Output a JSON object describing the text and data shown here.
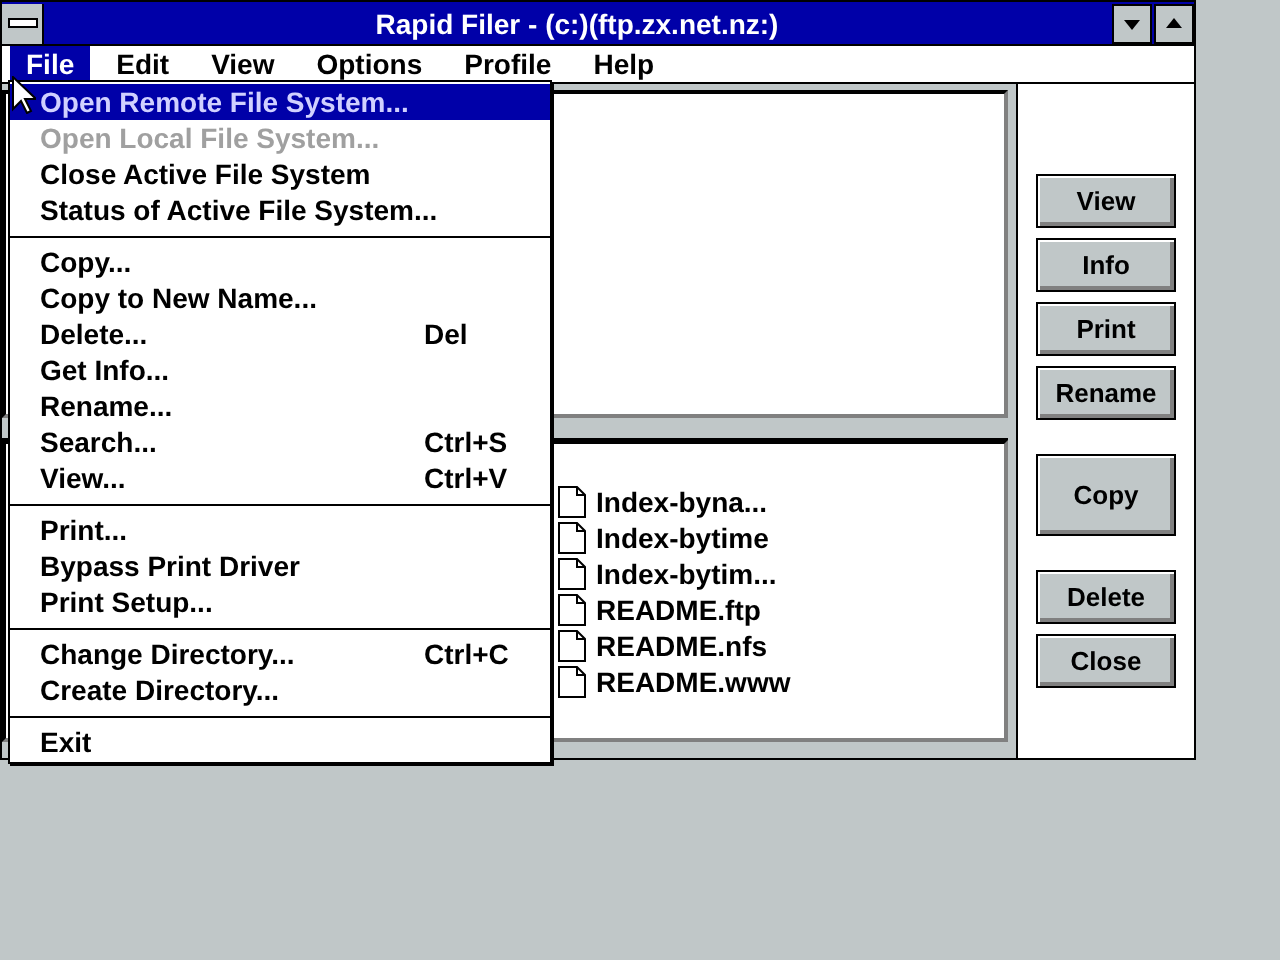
{
  "window": {
    "title": "Rapid Filer - (c:)(ftp.zx.net.nz:)"
  },
  "menu_bar": [
    {
      "label": "File",
      "selected": true
    },
    {
      "label": "Edit",
      "selected": false
    },
    {
      "label": "View",
      "selected": false
    },
    {
      "label": "Options",
      "selected": false
    },
    {
      "label": "Profile",
      "selected": false
    },
    {
      "label": "Help",
      "selected": false
    }
  ],
  "file_menu": [
    {
      "kind": "item",
      "label": "Open Remote File System...",
      "disabled": true,
      "selected": true
    },
    {
      "kind": "item",
      "label": "Open Local File System...",
      "disabled": true,
      "selected": false
    },
    {
      "kind": "item",
      "label": "Close Active File System",
      "disabled": false,
      "selected": false
    },
    {
      "kind": "item",
      "label": "Status of Active File System...",
      "disabled": false,
      "selected": false
    },
    {
      "kind": "separator"
    },
    {
      "kind": "item",
      "label": "Copy...",
      "disabled": false,
      "selected": false
    },
    {
      "kind": "item",
      "label": "Copy to New Name...",
      "disabled": false,
      "selected": false
    },
    {
      "kind": "item",
      "label": "Delete...",
      "shortcut": "Del",
      "disabled": false,
      "selected": false
    },
    {
      "kind": "item",
      "label": "Get Info...",
      "disabled": false,
      "selected": false
    },
    {
      "kind": "item",
      "label": "Rename...",
      "disabled": false,
      "selected": false
    },
    {
      "kind": "item",
      "label": "Search...",
      "shortcut": "Ctrl+S",
      "disabled": false,
      "selected": false
    },
    {
      "kind": "item",
      "label": "View...",
      "shortcut": "Ctrl+V",
      "disabled": false,
      "selected": false
    },
    {
      "kind": "separator"
    },
    {
      "kind": "item",
      "label": "Print...",
      "disabled": false,
      "selected": false
    },
    {
      "kind": "item",
      "label": "Bypass Print Driver",
      "disabled": false,
      "selected": false
    },
    {
      "kind": "item",
      "label": "Print Setup...",
      "disabled": false,
      "selected": false
    },
    {
      "kind": "separator"
    },
    {
      "kind": "item",
      "label": "Change Directory...",
      "shortcut": "Ctrl+C",
      "disabled": false,
      "selected": false
    },
    {
      "kind": "item",
      "label": "Create Directory...",
      "disabled": false,
      "selected": false
    },
    {
      "kind": "separator"
    },
    {
      "kind": "item",
      "label": "Exit",
      "disabled": false,
      "selected": false
    }
  ],
  "remote_files": [
    "Index-byna...",
    "Index-bytime",
    "Index-bytim...",
    "README.ftp",
    "README.nfs",
    "README.www"
  ],
  "buttons": [
    {
      "label": "View",
      "kind": "normal"
    },
    {
      "label": "Info",
      "kind": "normal"
    },
    {
      "label": "Print",
      "kind": "normal"
    },
    {
      "label": "Rename",
      "kind": "normal"
    },
    {
      "label": "Copy",
      "kind": "tall"
    },
    {
      "label": "Delete",
      "kind": "normal"
    },
    {
      "label": "Close",
      "kind": "normal"
    }
  ]
}
